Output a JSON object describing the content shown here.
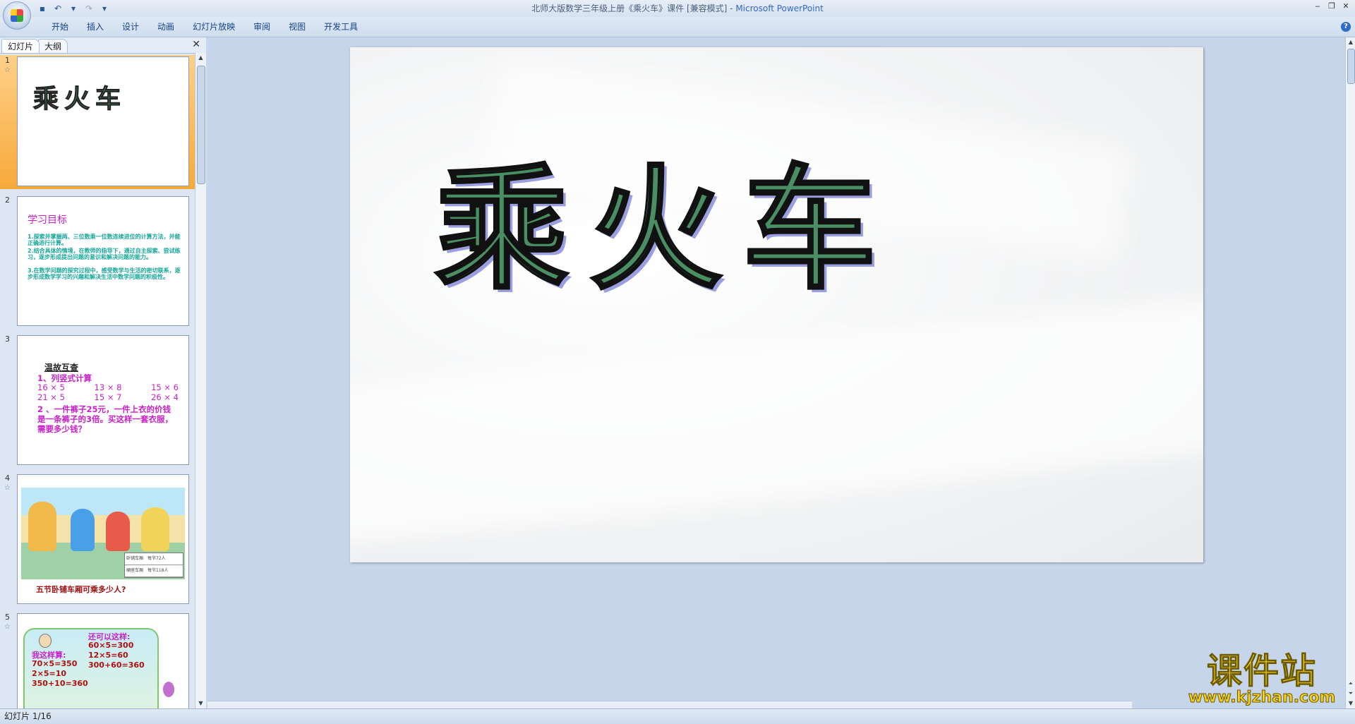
{
  "window": {
    "title": "北师大版数学三年级上册《乘火车》课件 [兼容模式] - ",
    "app_name": "Microsoft PowerPoint",
    "controls": [
      "‒",
      "❐",
      "✕"
    ]
  },
  "quick_access": {
    "save_icon": "▪",
    "undo_icon": "↶",
    "undo_dropdown": "▾",
    "redo_icon": "↷",
    "customize": "▾"
  },
  "ribbon": {
    "tabs": [
      "开始",
      "插入",
      "设计",
      "动画",
      "幻灯片放映",
      "审阅",
      "视图",
      "开发工具"
    ],
    "help": "?"
  },
  "pane": {
    "tabs": [
      "幻灯片",
      "大纲"
    ],
    "close": "✕"
  },
  "slides": [
    {
      "num": "1",
      "star": "☆",
      "title": "乘火车"
    },
    {
      "num": "2",
      "title": "学习目标",
      "items": [
        "1.探索并掌握两、三位数乘一位数连续进位的计算方法，并能正确进行计算。",
        "2.结合具体的情境，在教师的指导下，通过自主探索、尝试练习，逐步形成提出问题的意识和解决问题的能力。",
        "3.在数学问题的探究过程中，感受数学与生活的密切联系，逐步形成数学学习的兴趣和解决生活中数学问题的积极性。"
      ]
    },
    {
      "num": "3",
      "heading": "温故互查",
      "q1": "1、列竖式计算",
      "row1": [
        "16 × 5",
        "13 × 8",
        "15 × 6"
      ],
      "row2": [
        "21 × 5",
        "15 × 7",
        "26 × 4"
      ],
      "q2_lines": [
        "2 、一件裤子25元，一件上衣的价钱",
        "是一条裤子的3倍。买这样一套衣服，",
        "需要多少钱？"
      ]
    },
    {
      "num": "4",
      "star": "☆",
      "table": [
        "卧铺车厢　每节72人",
        "硬座车厢　每节118人"
      ],
      "caption": "五节卧铺车厢可乘多少人?"
    },
    {
      "num": "5",
      "star": "☆",
      "right_head": "还可以这样:",
      "right_lines": [
        "60×5=300",
        "12×5=60",
        "300+60=360"
      ],
      "left_head": "我这样算:",
      "left_lines": [
        "70×5=350",
        "2×5=10",
        "350+10=360"
      ]
    }
  ],
  "main_slide": {
    "title_chars": [
      "乘",
      "火",
      "车"
    ]
  },
  "status": {
    "slide_indicator": "幻灯片 1/16"
  },
  "watermark": {
    "line1": "课件站",
    "line2": "www.kjzhan.com"
  }
}
